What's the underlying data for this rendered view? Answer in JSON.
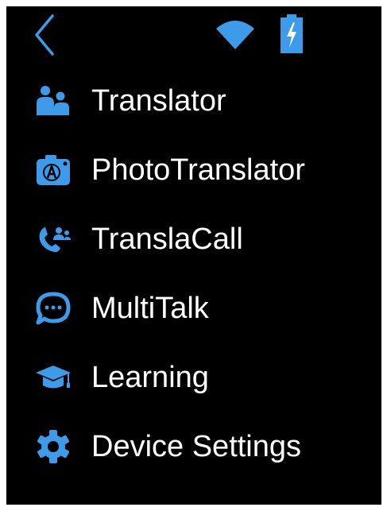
{
  "status_bar": {
    "back_icon": "chevron-left-icon",
    "wifi_icon": "wifi-icon",
    "battery_icon": "battery-charging-icon"
  },
  "menu": {
    "items": [
      {
        "label": "Translator",
        "icon": "people-icon"
      },
      {
        "label": "PhotoTranslator",
        "icon": "camera-translate-icon"
      },
      {
        "label": "TranslaCall",
        "icon": "phone-group-icon"
      },
      {
        "label": "MultiTalk",
        "icon": "chat-bubble-icon"
      },
      {
        "label": "Learning",
        "icon": "graduation-cap-icon"
      },
      {
        "label": "Device Settings",
        "icon": "gear-icon"
      }
    ]
  },
  "colors": {
    "background": "#000000",
    "accent": "#3d9bea",
    "text": "#ffffff"
  }
}
